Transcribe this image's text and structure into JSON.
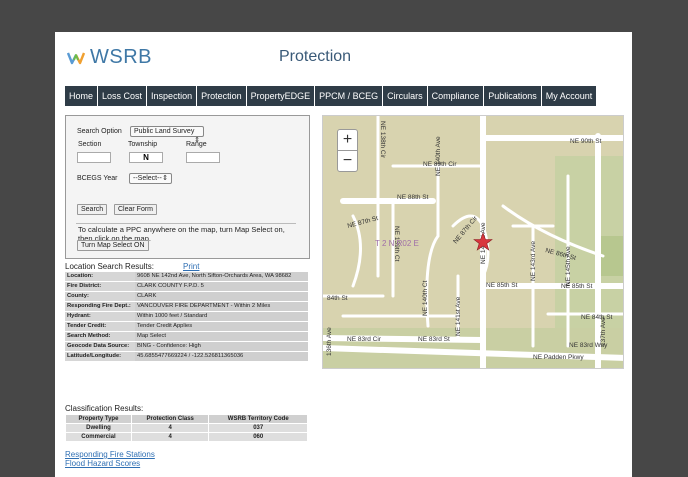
{
  "logo": {
    "text": "WSRB"
  },
  "page_title": "Protection",
  "nav": [
    "Home",
    "Loss Cost",
    "Inspection",
    "Protection",
    "PropertyEDGE",
    "PPCM / BCEG",
    "Circulars",
    "Compliance",
    "Publications",
    "My Account"
  ],
  "search": {
    "option_label": "Search Option",
    "option_value": "Public Land Survey",
    "section_label": "Section",
    "township_label": "Township",
    "range_label": "Range",
    "section_value": "",
    "township_value": "N",
    "range_value": "",
    "bcegs_label": "BCEGS Year",
    "bcegs_value": "--Select--",
    "search_button": "Search",
    "clear_button": "Clear Form",
    "instructions": "To calculate a PPC anywhere on the map, turn Map Select on, then click on the map.",
    "map_select_button": "Turn Map Select ON"
  },
  "results": {
    "heading": "Location Search Results:",
    "print": "Print",
    "rows": [
      {
        "k": "Location:",
        "v": "9608 NE 142nd Ave, North Sifton-Orchards Area, WA 98682"
      },
      {
        "k": "Fire District:",
        "v": "CLARK COUNTY F.P.D. 5"
      },
      {
        "k": "County:",
        "v": "CLARK"
      },
      {
        "k": "Responding Fire Dept.:",
        "v": "VANCOUVER FIRE DEPARTMENT - Within 2 Miles"
      },
      {
        "k": "Hydrant:",
        "v": "Within 1000 feet / Standard"
      },
      {
        "k": "Tender Credit:",
        "v": "Tender Credit Applies"
      },
      {
        "k": "Search Method:",
        "v": "Map Select"
      },
      {
        "k": "Geocode Data Source:",
        "v": "BING - Confidence: High"
      },
      {
        "k": "Latitude/Longitude:",
        "v": "45.6855477669224 / -122.526811365036"
      }
    ]
  },
  "classification": {
    "heading": "Classification Results:",
    "headers": [
      "Property Type",
      "Protection Class",
      "WSRB Territory Code"
    ],
    "rows": [
      [
        "Dwelling",
        "4",
        "037"
      ],
      [
        "Commercial",
        "4",
        "060"
      ]
    ]
  },
  "links": {
    "fire": "Responding Fire Stations",
    "flood": "Flood Hazard Scores"
  },
  "map": {
    "zoom_in": "+",
    "zoom_out": "−",
    "labels": {
      "ne90": "NE 90th St",
      "ne89": "NE 89th Cir",
      "ne88": "NE 88th St",
      "ne87": "NE 87th St",
      "ne87c": "NE 87th Cir",
      "ne86": "NE 86th St",
      "ne85": "NE 85th St",
      "ne84": "84th St",
      "ne84b": "NE 84th St",
      "ne83": "NE 83rd Cir",
      "ne83b": "NE 83rd St",
      "ne83w": "NE 83rd Way",
      "padden": "NE Padden Pkwy",
      "ave136": "136th Ave",
      "ave138": "NE 138th Cir",
      "ave139": "NE 139th Ct",
      "ave140": "NE 140th Ave",
      "ave140c": "NE 140th Ct",
      "ave141": "NE 141st Ave",
      "ave142": "NE 142nd Ave",
      "ave143": "NE 143rd Ave",
      "ave145": "NE 145th Ave",
      "ave137": "137th Ave",
      "trs": "T 2 N R02 E"
    },
    "accent": "#d9363e"
  }
}
